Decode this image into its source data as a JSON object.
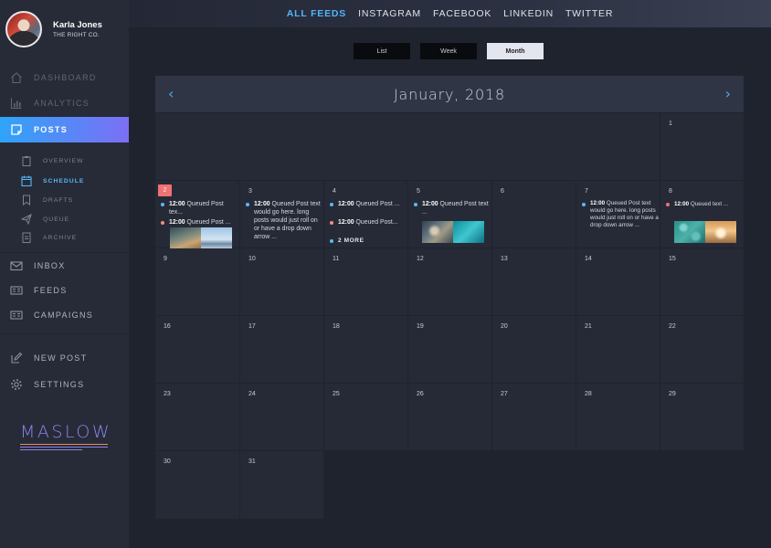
{
  "user": {
    "name": "Karla Jones",
    "company": "THE RIGHT CO."
  },
  "nav": {
    "dashboard": "DASHBOARD",
    "analytics": "ANALYTICS",
    "posts": "POSTS",
    "overview": "OVERVIEW",
    "schedule": "SCHEDULE",
    "drafts": "DRAFTS",
    "queue": "QUEUE",
    "archive": "ARCHIVE",
    "inbox": "INBOX",
    "feeds": "FEEDS",
    "campaigns": "CAMPAIGNS",
    "new_post": "NEW POST",
    "settings": "SETTINGS"
  },
  "brand": {
    "logo": "MASLOW"
  },
  "feeds": {
    "all": "ALL FEEDS",
    "instagram": "INSTAGRAM",
    "facebook": "FACEBOOK",
    "linkedin": "LINKEDIN",
    "twitter": "TWITTER"
  },
  "views": {
    "list": "List",
    "week": "Week",
    "month": "Month",
    "selected": "Month"
  },
  "calendar": {
    "title": "January, 2018",
    "prev_icon": "chevron-left-icon",
    "next_icon": "chevron-right-icon",
    "days": {
      "d1": "1",
      "d2": "2",
      "d3": "3",
      "d4": "4",
      "d5": "5",
      "d6": "6",
      "d7": "7",
      "d8": "8",
      "d9": "9",
      "d10": "10",
      "d11": "11",
      "d12": "12",
      "d13": "13",
      "d14": "14",
      "d15": "15",
      "d16": "16",
      "d17": "17",
      "d18": "18",
      "d19": "19",
      "d20": "20",
      "d21": "21",
      "d22": "22",
      "d23": "23",
      "d24": "24",
      "d25": "25",
      "d26": "26",
      "d27": "27",
      "d28": "28",
      "d29": "29",
      "d30": "30",
      "d31": "31"
    },
    "events": {
      "e2a_time": "12:00",
      "e2a_text": "Queued Post tex...",
      "e2b_time": "12:00",
      "e2b_text": "Queued Post ...",
      "e3_time": "12:00",
      "e3_text": "Queued Post text would go here. long posts would just roll on or have a drop down arrow ...",
      "e4a_time": "12:00",
      "e4a_text": "Queued Post ...",
      "e4b_time": "12:00",
      "e4b_text": "Queued Post...",
      "e4_more": "2 MORE",
      "e5_time": "12:00",
      "e5_text": "Queued Post text ...",
      "e7_time": "12:00",
      "e7_text": "Queued Post text would go here. long posts would just roll on or have a drop down arrow ...",
      "e8_time": "12:00",
      "e8_text": "Queued  text ..."
    }
  },
  "colors": {
    "accent_blue": "#52b4f7",
    "accent_purple": "#7b6ff6",
    "today": "#f07272",
    "dot_blue": "#5ab8f6",
    "dot_salmon": "#f0907a"
  }
}
